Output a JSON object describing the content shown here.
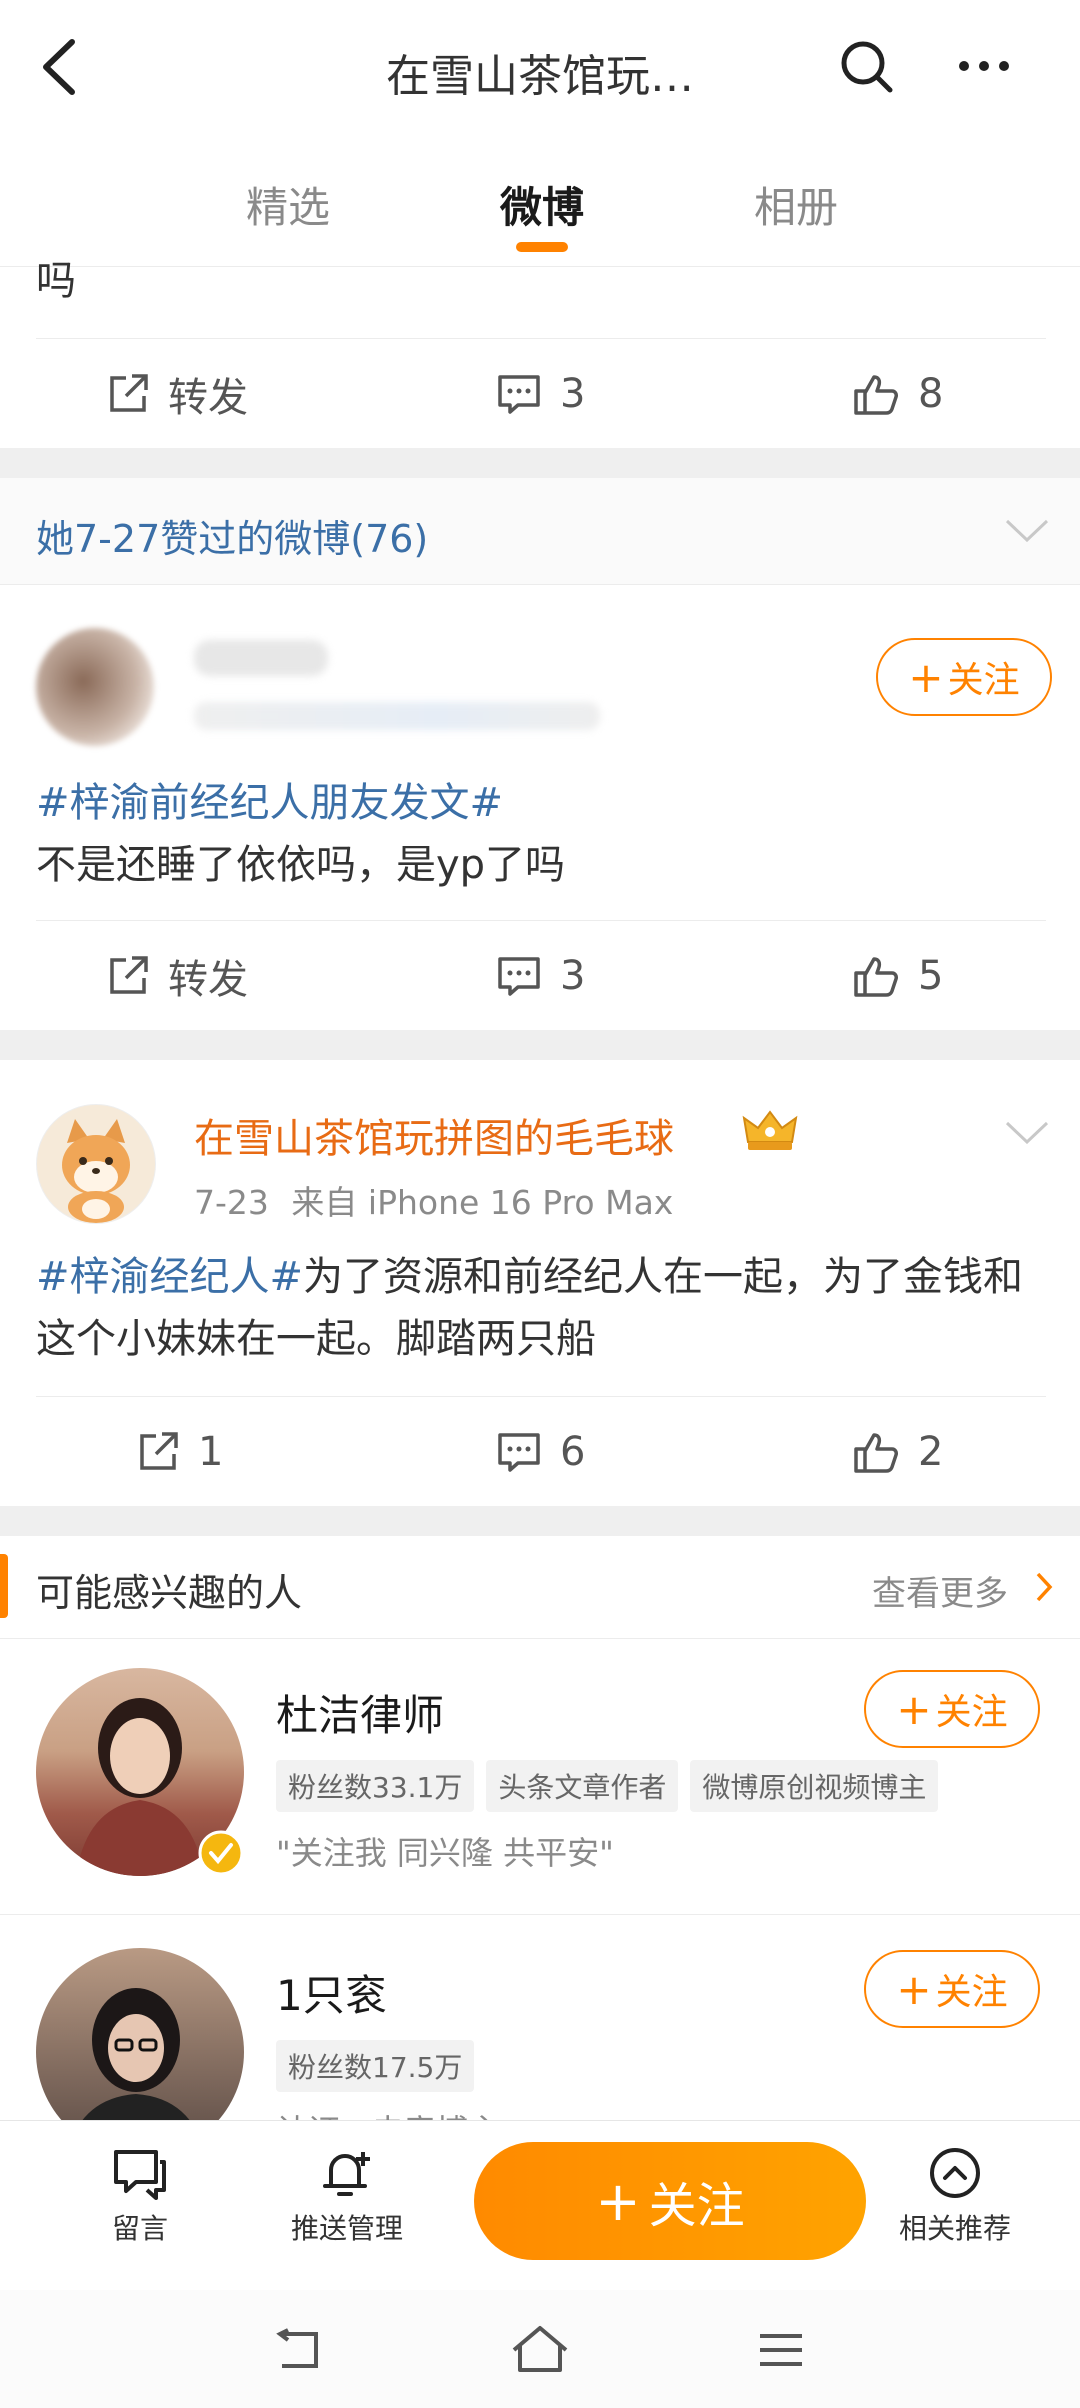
{
  "header": {
    "title": "在雪山茶馆玩…"
  },
  "tabs": [
    {
      "label": "精选"
    },
    {
      "label": "微博"
    },
    {
      "label": "相册"
    }
  ],
  "post0": {
    "text_tail": "吗",
    "repost_label": "转发",
    "comments": "3",
    "likes": "8"
  },
  "liked_section": {
    "title": "她7-27赞过的微博(76)"
  },
  "post1": {
    "follow_label": "关注",
    "topic": "#梓渝前经纪人朋友发文#",
    "text": "不是还睡了依依吗，是yp了吗",
    "repost_label": "转发",
    "comments": "3",
    "likes": "5"
  },
  "post2": {
    "author": "在雪山茶馆玩拼图的毛毛球",
    "date": "7-23",
    "source": "来自 iPhone 16 Pro Max",
    "topic": "#梓渝经纪人#",
    "text": "为了资源和前经纪人在一起，为了金钱和这个小妹妹在一起。脚踏两只船",
    "reposts": "1",
    "comments": "6",
    "likes": "2"
  },
  "suggest": {
    "title": "可能感兴趣的人",
    "more": "查看更多",
    "users": [
      {
        "name": "杜洁律师",
        "follow_label": "关注",
        "tags": [
          "粉丝数33.1万",
          "头条文章作者",
          "微博原创视频博主"
        ],
        "bio": "\"关注我 同兴隆 共平安\""
      },
      {
        "name": "1只衮",
        "follow_label": "关注",
        "tags": [
          "粉丝数17.5万"
        ],
        "bio": "认证：电竞博主"
      }
    ]
  },
  "bottom": {
    "message": "留言",
    "push": "推送管理",
    "follow": "关注",
    "related": "相关推荐"
  },
  "colors": {
    "accent": "#ff8200",
    "link": "#3b6fa7",
    "username": "#e86b14"
  }
}
